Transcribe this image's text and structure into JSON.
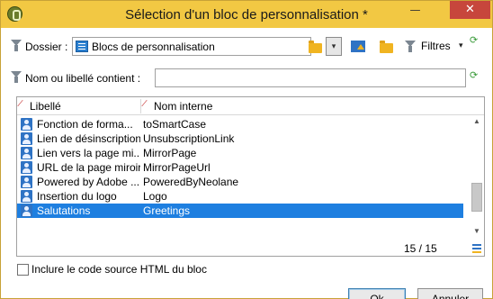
{
  "window": {
    "title": "Sélection d'un bloc de personnalisation *",
    "minimize_glyph": "—",
    "close_glyph": "✕"
  },
  "toolbar": {
    "folder_label": "Dossier :",
    "folder_value": "Blocs de personnalisation",
    "dropdown_glyph": "▾",
    "filters_label": "Filtres",
    "filters_arrow": "▾",
    "refresh_glyph": "⟳"
  },
  "search": {
    "label": "Nom ou libellé contient :",
    "value": ""
  },
  "grid": {
    "columns": [
      "Libellé",
      "Nom interne"
    ],
    "rows": [
      {
        "label": "Fonction de forma...",
        "internal": "toSmartCase",
        "selected": false
      },
      {
        "label": "Lien de désinscription",
        "internal": "UnsubscriptionLink",
        "selected": false
      },
      {
        "label": "Lien vers la page mi...",
        "internal": "MirrorPage",
        "selected": false
      },
      {
        "label": "URL de la page miroir",
        "internal": "MirrorPageUrl",
        "selected": false
      },
      {
        "label": "Powered by Adobe ...",
        "internal": "PoweredByNeolane",
        "selected": false
      },
      {
        "label": "Insertion du logo",
        "internal": "Logo",
        "selected": false
      },
      {
        "label": "Salutations",
        "internal": "Greetings",
        "selected": true
      }
    ],
    "count": "15 / 15",
    "scroll_up": "▲",
    "scroll_down": "▼"
  },
  "include_html": {
    "label": "Inclure le code source HTML du bloc",
    "checked": false
  },
  "buttons": {
    "ok": "Ok",
    "cancel": "Annuler"
  },
  "colors": {
    "titlebar": "#f2c843",
    "selection": "#1e7fe0"
  }
}
